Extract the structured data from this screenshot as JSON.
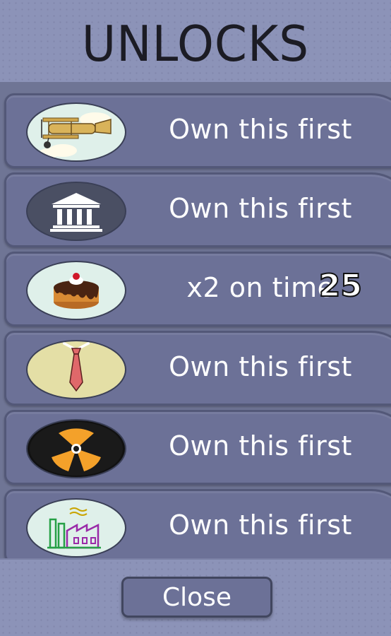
{
  "header": {
    "title": "UNLOCKS"
  },
  "colors": {
    "background": "#8c93b8",
    "row": "#6c7197",
    "row_border": "#535878",
    "text": "#ffffff",
    "title": "#1c1c24"
  },
  "unlocks": [
    {
      "icon": "biplane-icon",
      "label": "Own this first",
      "count": ""
    },
    {
      "icon": "bank-icon",
      "label": "Own this first",
      "count": ""
    },
    {
      "icon": "cake-icon",
      "label": "x2 on time",
      "count": "25"
    },
    {
      "icon": "tie-icon",
      "label": "Own this first",
      "count": ""
    },
    {
      "icon": "radiation-icon",
      "label": "Own this first",
      "count": ""
    },
    {
      "icon": "factory-icon",
      "label": "Own this first",
      "count": ""
    }
  ],
  "footer": {
    "close_label": "Close"
  }
}
